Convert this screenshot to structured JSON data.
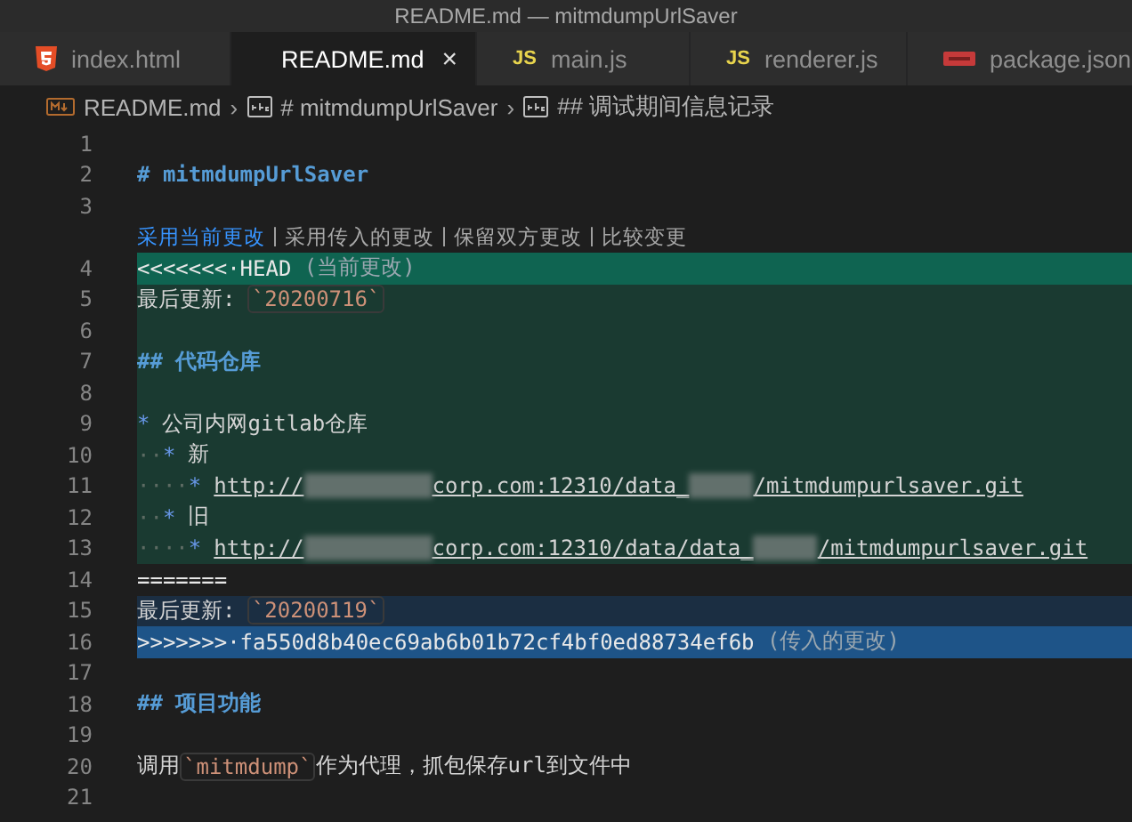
{
  "window": {
    "title": "README.md — mitmdumpUrlSaver"
  },
  "tabs": [
    {
      "label": "index.html",
      "kind": "html",
      "selected": false
    },
    {
      "label": "README.md",
      "kind": "markdown",
      "selected": true,
      "close": "×"
    },
    {
      "label": "main.js",
      "kind": "js",
      "badge": "JS",
      "selected": false
    },
    {
      "label": "renderer.js",
      "kind": "js",
      "badge": "JS",
      "selected": false
    },
    {
      "label": "package.json",
      "kind": "json",
      "selected": false
    }
  ],
  "breadcrumb": [
    {
      "label": "README.md",
      "kind": "markdown"
    },
    {
      "label": "# mitmdumpUrlSaver",
      "kind": "symbol",
      "separator": "›"
    },
    {
      "label": "## 调试期间信息记录",
      "kind": "symbol",
      "separator": "›"
    }
  ],
  "lines": [
    {
      "kind": "code",
      "number": "1",
      "current": false,
      "incoming": false,
      "conflict_header": false
    },
    {
      "kind": "code",
      "number": "2",
      "current": false,
      "incoming": false,
      "conflict_header": false,
      "segments": [
        {
          "kind": "heading",
          "text": "# mitmdumpUrlSaver"
        }
      ]
    },
    {
      "kind": "code",
      "number": "3",
      "current": false,
      "incoming": false,
      "conflict_header": false
    },
    {
      "kind": "codelens",
      "actions": [
        {
          "label": "采用当前更改",
          "hovered": true
        },
        {
          "label": "采用传入的更改",
          "hovered": false,
          "separator": "|"
        },
        {
          "label": "保留双方更改",
          "hovered": false,
          "separator": "|"
        },
        {
          "label": "比较变更",
          "hovered": false,
          "separator": "|"
        }
      ]
    },
    {
      "kind": "code",
      "number": "4",
      "current": true,
      "incoming": false,
      "conflict_header": true,
      "segments": [
        {
          "kind": "conflict",
          "text": "<<<<<<<·HEAD"
        },
        {
          "kind": "hint",
          "text": " (当前更改)"
        }
      ]
    },
    {
      "kind": "code",
      "number": "5",
      "current": true,
      "incoming": false,
      "conflict_header": false,
      "segments": [
        {
          "kind": "text",
          "text": "最后更新: "
        },
        {
          "kind": "code",
          "text": "`20200716`"
        }
      ]
    },
    {
      "kind": "code",
      "number": "6",
      "current": true,
      "incoming": false,
      "conflict_header": false
    },
    {
      "kind": "code",
      "number": "7",
      "current": true,
      "incoming": false,
      "conflict_header": false,
      "segments": [
        {
          "kind": "heading",
          "text": "## 代码仓库"
        }
      ]
    },
    {
      "kind": "code",
      "number": "8",
      "current": true,
      "incoming": false,
      "conflict_header": false
    },
    {
      "kind": "code",
      "number": "9",
      "current": true,
      "incoming": false,
      "conflict_header": false,
      "segments": [
        {
          "kind": "bullet",
          "text": "*"
        },
        {
          "kind": "text",
          "text": "公司内网gitlab仓库"
        }
      ]
    },
    {
      "kind": "code",
      "number": "10",
      "current": true,
      "incoming": false,
      "conflict_header": false,
      "segments": [
        {
          "kind": "ws",
          "text": "··"
        },
        {
          "kind": "bullet",
          "text": "*"
        },
        {
          "kind": "text",
          "text": "新"
        }
      ]
    },
    {
      "kind": "code",
      "number": "11",
      "current": true,
      "incoming": false,
      "conflict_header": false,
      "segments": [
        {
          "kind": "ws",
          "text": "····"
        },
        {
          "kind": "bullet",
          "text": "*"
        },
        {
          "kind": "link",
          "text": "http://"
        },
        {
          "kind": "redacted-long"
        },
        {
          "kind": "link",
          "text": "corp.com:12310/data_"
        },
        {
          "kind": "redacted-short"
        },
        {
          "kind": "link",
          "text": "/mitmdumpurlsaver.git"
        }
      ]
    },
    {
      "kind": "code",
      "number": "12",
      "current": true,
      "incoming": false,
      "conflict_header": false,
      "segments": [
        {
          "kind": "ws",
          "text": "··"
        },
        {
          "kind": "bullet",
          "text": "*"
        },
        {
          "kind": "text",
          "text": "旧"
        }
      ]
    },
    {
      "kind": "code",
      "number": "13",
      "current": true,
      "incoming": false,
      "conflict_header": false,
      "segments": [
        {
          "kind": "ws",
          "text": "····"
        },
        {
          "kind": "bullet",
          "text": "*"
        },
        {
          "kind": "link",
          "text": "http://"
        },
        {
          "kind": "redacted-long"
        },
        {
          "kind": "link",
          "text": "corp.com:12310/data/data_"
        },
        {
          "kind": "redacted-short"
        },
        {
          "kind": "link",
          "text": "/mitmdumpurlsaver.git"
        }
      ]
    },
    {
      "kind": "code",
      "number": "14",
      "current": false,
      "incoming": false,
      "conflict_header": false,
      "segments": [
        {
          "kind": "conflict",
          "text": "======="
        }
      ]
    },
    {
      "kind": "code",
      "number": "15",
      "current": false,
      "incoming": true,
      "conflict_header": false,
      "segments": [
        {
          "kind": "text",
          "text": "最后更新: "
        },
        {
          "kind": "code",
          "text": "`20200119`"
        }
      ]
    },
    {
      "kind": "code",
      "number": "16",
      "current": false,
      "incoming": true,
      "conflict_header": true,
      "segments": [
        {
          "kind": "conflict",
          "text": ">>>>>>>·fa550d8b40ec69ab6b01b72cf4bf0ed88734ef6b"
        },
        {
          "kind": "hint",
          "text": " (传入的更改)"
        }
      ]
    },
    {
      "kind": "code",
      "number": "17",
      "current": false,
      "incoming": false,
      "conflict_header": false
    },
    {
      "kind": "code",
      "number": "18",
      "current": false,
      "incoming": false,
      "conflict_header": false,
      "segments": [
        {
          "kind": "heading",
          "text": "## 项目功能"
        }
      ]
    },
    {
      "kind": "code",
      "number": "19",
      "current": false,
      "incoming": false,
      "conflict_header": false
    },
    {
      "kind": "code",
      "number": "20",
      "current": false,
      "incoming": false,
      "conflict_header": false,
      "segments": [
        {
          "kind": "text",
          "text": "调用"
        },
        {
          "kind": "code",
          "text": "`mitmdump`"
        },
        {
          "kind": "text",
          "text": "作为代理，抓包保存url到文件中"
        }
      ]
    },
    {
      "kind": "code",
      "number": "21",
      "current": false,
      "incoming": false,
      "conflict_header": false
    }
  ]
}
